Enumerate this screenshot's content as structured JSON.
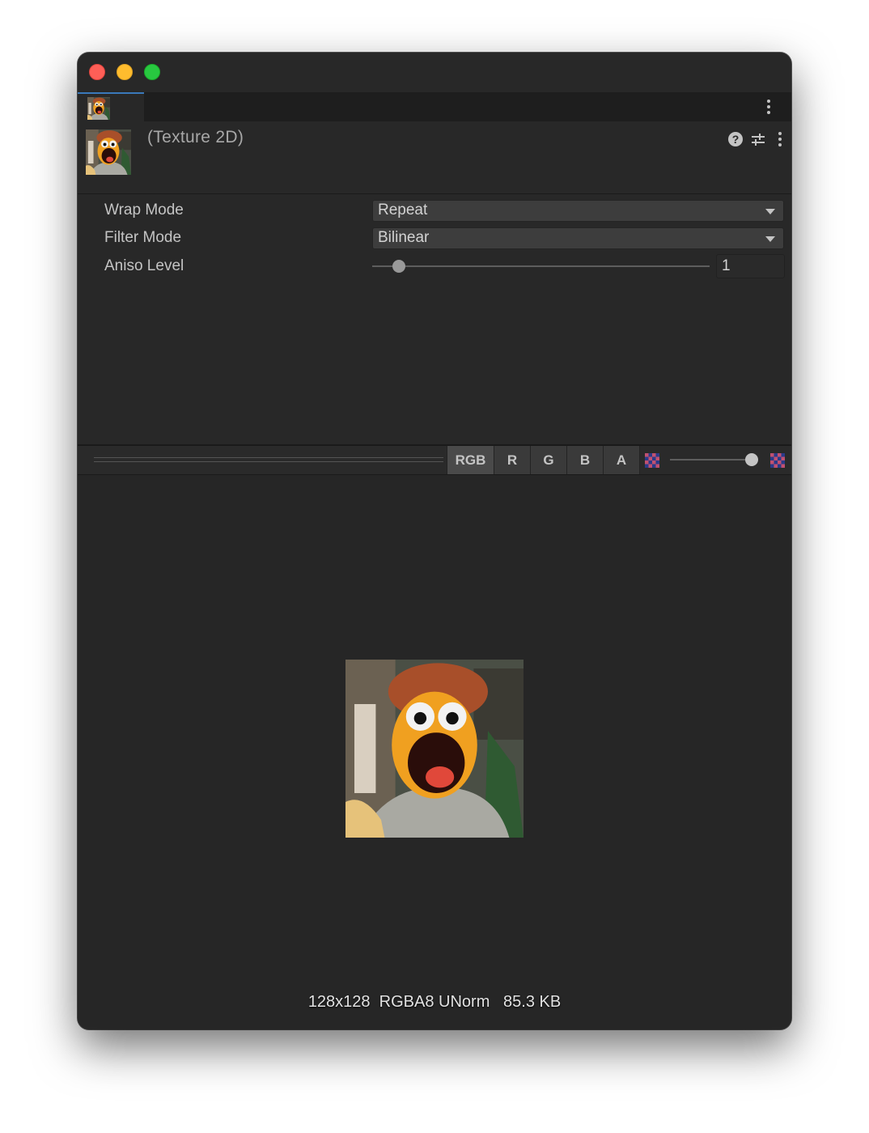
{
  "window": {
    "title_icon": "texture-thumbnail"
  },
  "header": {
    "title": "(Texture 2D)",
    "help_icon": "question-mark-icon",
    "presets_icon": "sliders-icon",
    "menu_icon": "kebab-icon"
  },
  "properties": {
    "wrap_mode": {
      "label": "Wrap Mode",
      "value": "Repeat"
    },
    "filter_mode": {
      "label": "Filter Mode",
      "value": "Bilinear"
    },
    "aniso_level": {
      "label": "Aniso Level",
      "value": "1",
      "slider_fraction": 0.06
    }
  },
  "preview_toolbar": {
    "channels": [
      "RGB",
      "R",
      "G",
      "B",
      "A"
    ],
    "active_channel": "RGB",
    "mip_slider_fraction": 1.0
  },
  "preview": {
    "info": "128x128  RGBA8 UNorm   85.3 KB"
  }
}
